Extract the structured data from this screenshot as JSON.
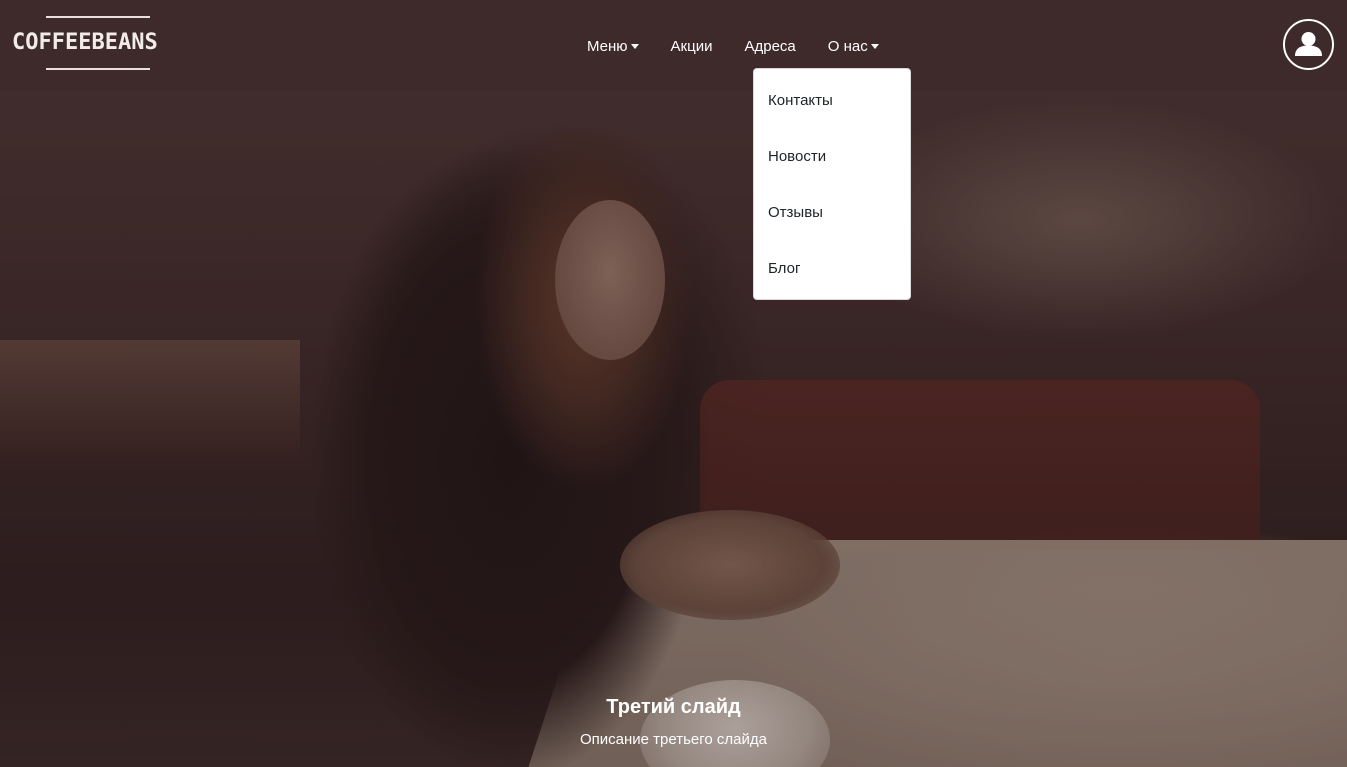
{
  "brand": {
    "logo_text": "COFFEEBEANS"
  },
  "nav": {
    "items": [
      {
        "label": "Меню",
        "has_dropdown": true
      },
      {
        "label": "Акции",
        "has_dropdown": false
      },
      {
        "label": "Адреса",
        "has_dropdown": false
      },
      {
        "label": "О нас",
        "has_dropdown": true
      }
    ]
  },
  "user": {
    "icon": "user-icon"
  },
  "dropdown": {
    "open_under": "О нас",
    "items": [
      "Контакты",
      "Новости",
      "Отзывы",
      "Блог"
    ]
  },
  "carousel": {
    "caption_title": "Третий слайд",
    "caption_text": "Описание третьего слайда"
  },
  "colors": {
    "navbar_bg": "#3e2a2b",
    "nav_text": "#ffffff",
    "dropdown_bg": "#ffffff",
    "dropdown_text": "#212529"
  }
}
